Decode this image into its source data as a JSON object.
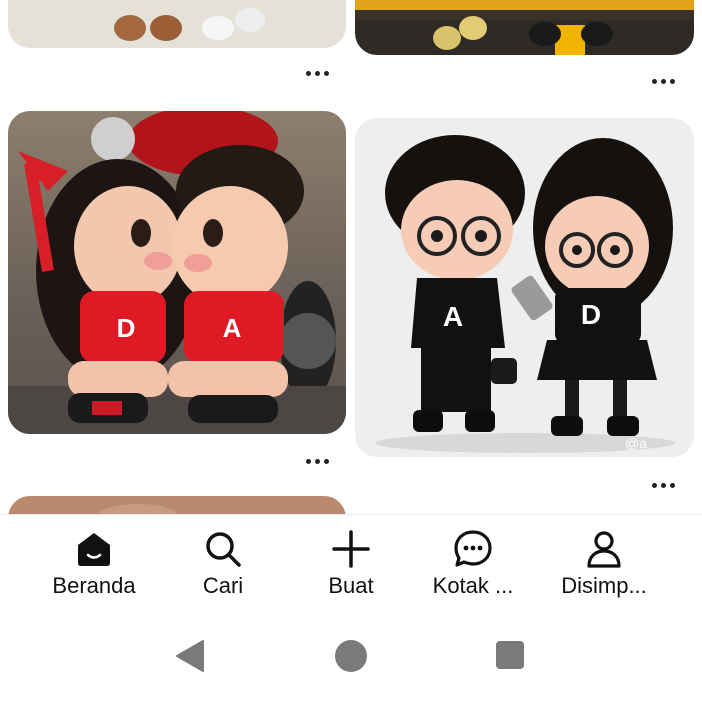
{
  "colors": {
    "nav_icon": "#111111",
    "system_buttons": "#7a7a7a",
    "shirt_red": "#e01a24",
    "outfit_black": "#111111"
  },
  "pins": {
    "pin3": {
      "shirt_letters": [
        "D",
        "A"
      ]
    },
    "pin4": {
      "shirt_letters": [
        "A",
        "D"
      ],
      "watermark": "@a"
    }
  },
  "bottom_nav": {
    "items": [
      {
        "label": "Beranda",
        "icon": "home-icon",
        "active": true
      },
      {
        "label": "Cari",
        "icon": "search-icon"
      },
      {
        "label": "Buat",
        "icon": "plus-icon"
      },
      {
        "label": "Kotak ...",
        "icon": "chat-bubble-icon"
      },
      {
        "label": "Disimp...",
        "icon": "profile-icon"
      }
    ]
  },
  "system_nav": {
    "buttons": [
      "back-icon",
      "home-circle-icon",
      "recents-icon"
    ]
  }
}
